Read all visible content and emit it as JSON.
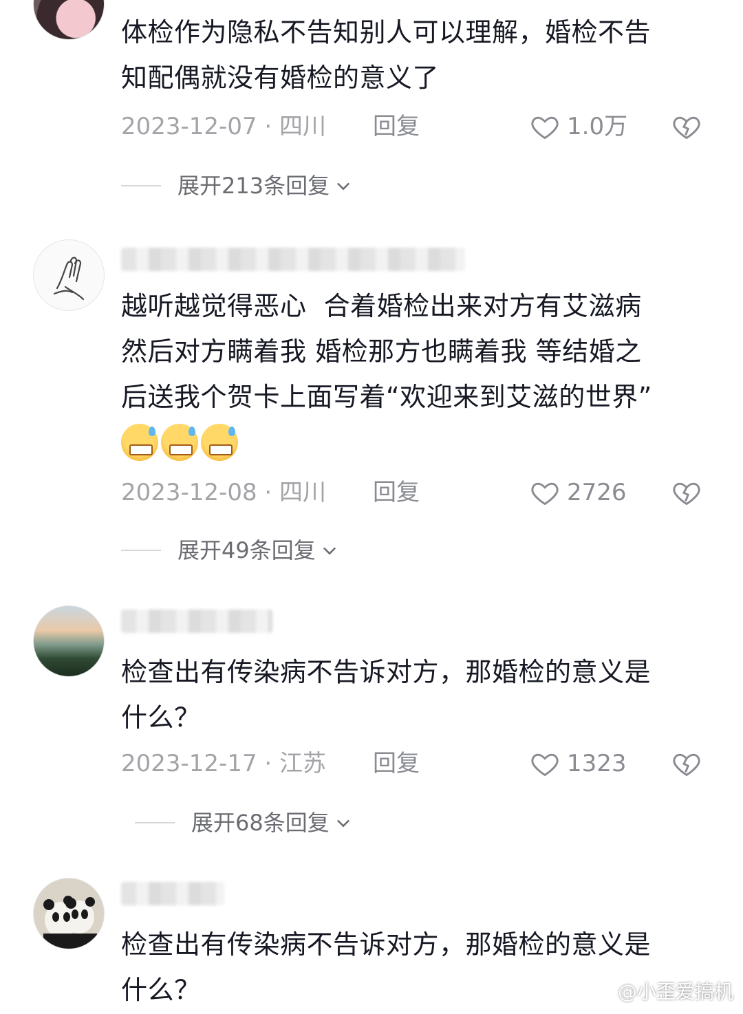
{
  "comments": [
    {
      "text": "体检作为隐私不告知别人可以理解，婚检不告\n知配偶就没有婚检的意义了",
      "date_location": "2023-12-07 · 四川",
      "reply_label": "回复",
      "likes": "1.0万",
      "expand_label": "展开213条回复"
    },
    {
      "text": "越听越觉得恶心  合着婚检出来对方有艾滋病\n然后对方瞒着我 婚检那方也瞒着我 等结婚之\n后送我个贺卡上面写着“欢迎来到艾滋的世界”",
      "emojis": [
        "grin-sweat-emoji",
        "grin-sweat-emoji",
        "grin-sweat-emoji"
      ],
      "date_location": "2023-12-08 · 四川",
      "reply_label": "回复",
      "likes": "2726",
      "expand_label": "展开49条回复"
    },
    {
      "text": "检查出有传染病不告诉对方，那婚检的意义是\n什么？",
      "date_location": "2023-12-17 · 江苏",
      "reply_label": "回复",
      "likes": "1323",
      "expand_label": "展开68条回复"
    },
    {
      "text": "检查出有传染病不告诉对方，那婚检的意义是\n什么？"
    }
  ],
  "watermark": "@小歪爱搞机",
  "icons": {
    "like": "heart-outline-icon",
    "dislike": "broken-heart-icon",
    "expand": "chevron-down-icon",
    "watermark": "weibo-logo-icon"
  }
}
